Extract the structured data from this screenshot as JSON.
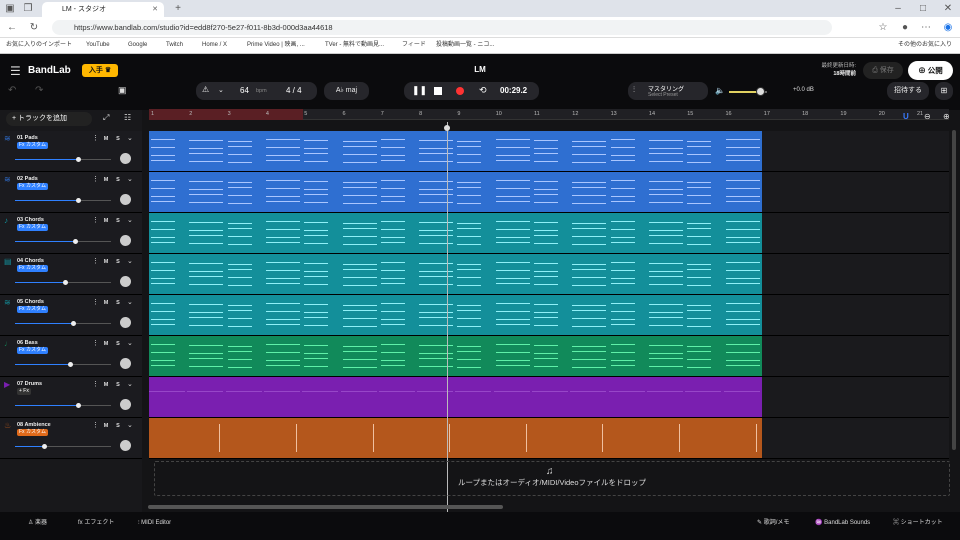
{
  "browser": {
    "tab_title": "LM - スタジオ",
    "url": "https://www.bandlab.com/studio?id=edd8f270-5e27-f011-8b3d-000d3aa44618",
    "bookmarks": [
      "お気に入りのインポート",
      "YouTube",
      "Google",
      "Twitch",
      "Home / X",
      "Prime Video | 映画, ...",
      "TVer - 無料で動画見...",
      "フィード",
      "投稿動画一覧 - ニコ..."
    ],
    "other_favorites": "その他のお気に入り"
  },
  "header": {
    "logo": "BandLab",
    "get_label": "入手",
    "project_title": "LM",
    "bpm": "64",
    "bpm_unit": "bpm",
    "time_sig": "4 / 4",
    "key": "A♭ maj",
    "time": "00:29.2",
    "mastering_label": "マスタリング",
    "mastering_preset": "Select Preset",
    "volume_db": "+0.0 dB",
    "last_updated_label": "最終更新日時:",
    "last_updated_value": "18時間前",
    "save_label": "保存",
    "publish_label": "公開",
    "invite_label": "招待する"
  },
  "tracks_panel": {
    "add_track_label": "トラックを追加"
  },
  "tracks": [
    {
      "name": "01  Pads",
      "fx": "Fx カスタム",
      "fx_color": "#2f80ff",
      "clip_color": "#2f6fd1",
      "note_color": "#a9c6ff",
      "icon": "synth-icon",
      "level": 0.66
    },
    {
      "name": "02  Pads",
      "fx": "Fx カスタム",
      "fx_color": "#2f80ff",
      "clip_color": "#2f6fd1",
      "note_color": "#a9c6ff",
      "icon": "synth-icon",
      "level": 0.66
    },
    {
      "name": "03  Chords",
      "fx": "Fx カスタム",
      "fx_color": "#2f80ff",
      "clip_color": "#138f9a",
      "note_color": "#8ff0f7",
      "icon": "piano-icon",
      "level": 0.63
    },
    {
      "name": "04  Chords",
      "fx": "Fx カスタム",
      "fx_color": "#2f80ff",
      "clip_color": "#138f9a",
      "note_color": "#8ff0f7",
      "icon": "keyboard-icon",
      "level": 0.52
    },
    {
      "name": "05  Chords",
      "fx": "Fx カスタム",
      "fx_color": "#2f80ff",
      "clip_color": "#138f9a",
      "note_color": "#8ff0f7",
      "icon": "synth-icon",
      "level": 0.6
    },
    {
      "name": "06  Bass",
      "fx": "Fx カスタム",
      "fx_color": "#2f80ff",
      "clip_color": "#118a5a",
      "note_color": "#5ff0a8",
      "icon": "bass-icon",
      "level": 0.57
    },
    {
      "name": "07  Drums",
      "fx": "+ Fx",
      "fx_color": "#333",
      "clip_color": "#7a1fb0",
      "note_color": "#b46de0",
      "icon": "drums-icon",
      "level": 0.66
    },
    {
      "name": "08  Ambience",
      "fx": "Fx カスタム",
      "fx_color": "#e06a1a",
      "clip_color": "#b4571c",
      "note_color": "#f0c0a0",
      "icon": "mic-icon",
      "level": 0.3
    }
  ],
  "ruler": {
    "bars": [
      "1",
      "2",
      "3",
      "4",
      "5",
      "6",
      "7",
      "8",
      "9",
      "10",
      "11",
      "12",
      "13",
      "14",
      "15",
      "16",
      "17",
      "18",
      "19",
      "20",
      "21"
    ]
  },
  "drop_zone": {
    "text": "ループまたはオーディオ/MIDI/Videoファイルをドロップ"
  },
  "bottom_bar": {
    "instrument": "楽器",
    "effects": "エフェクト",
    "midi_editor": "MIDI Editor",
    "lyrics": "歌詞/メモ",
    "sounds": "BandLab Sounds",
    "shortcuts": "ショートカット"
  }
}
